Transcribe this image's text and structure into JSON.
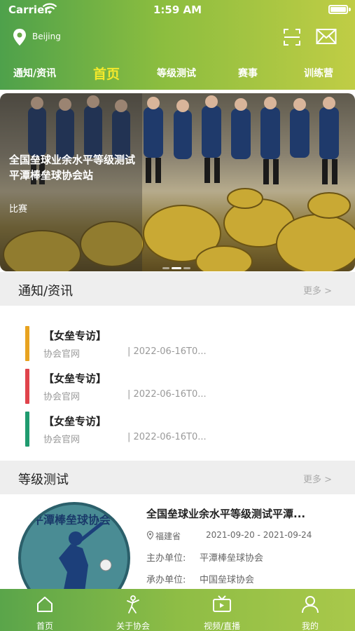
{
  "status_bar": {
    "carrier": "Carrier",
    "time": "1:59 AM"
  },
  "header": {
    "location": "Beijing"
  },
  "top_nav": {
    "items": [
      {
        "label": "通知/资讯"
      },
      {
        "label": "首页"
      },
      {
        "label": "等级测试"
      },
      {
        "label": "赛事"
      },
      {
        "label": "训练营"
      }
    ]
  },
  "banner": {
    "title": "全国垒球业余水平等级测试平潭棒垒球协会站",
    "tag": "比赛"
  },
  "news_section": {
    "title": "通知/资讯",
    "more": "更多 >",
    "items": [
      {
        "title": "【女垒专访】",
        "source": "协会官网",
        "date": "| 2022-06-16T0...",
        "color": "#e8a320"
      },
      {
        "title": "【女垒专访】",
        "source": "协会官网",
        "date": "| 2022-06-16T0...",
        "color": "#e0434b"
      },
      {
        "title": "【女垒专访】",
        "source": "协会官网",
        "date": "| 2022-06-16T0...",
        "color": "#1f9b6f"
      }
    ]
  },
  "grade_section": {
    "title": "等级测试",
    "more": "更多 >",
    "event": {
      "title": "全国垒球业余水平等级测试平潭...",
      "location": "福建省",
      "dates": "2021-09-20 - 2021-09-24",
      "organizer_label": "主办单位:",
      "organizer": "平潭棒垒球协会",
      "host_label": "承办单位:",
      "host": "中国垒球协会",
      "logo_text": "平潭棒垒球协会"
    }
  },
  "tab_bar": {
    "items": [
      {
        "label": "首页",
        "icon": "home-icon"
      },
      {
        "label": "关于协会",
        "icon": "player-icon"
      },
      {
        "label": "视频/直播",
        "icon": "tv-icon"
      },
      {
        "label": "我的",
        "icon": "person-icon"
      }
    ]
  }
}
